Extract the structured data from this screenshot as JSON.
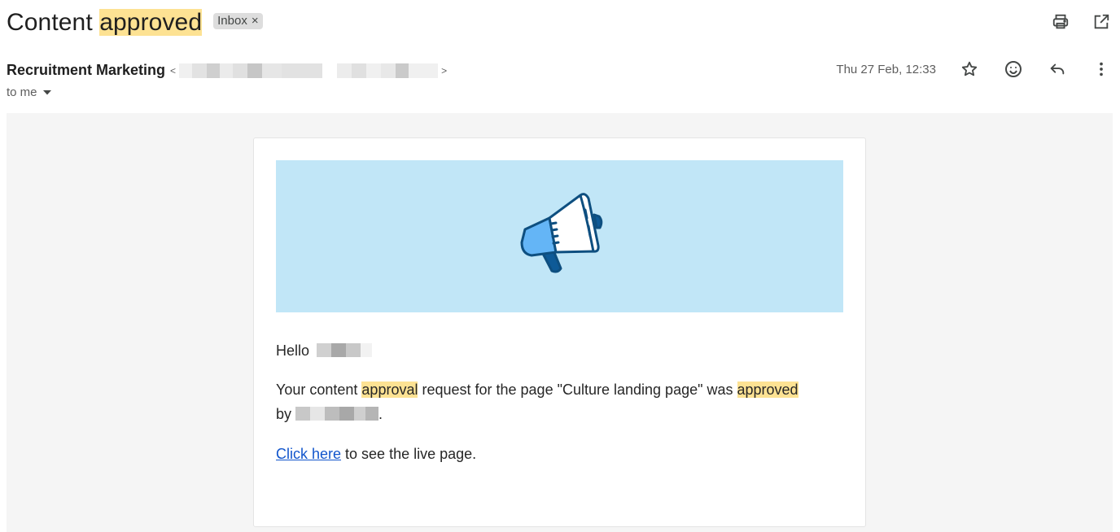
{
  "email": {
    "subject_prefix": "Content ",
    "subject_highlight": "approved",
    "label": "Inbox",
    "label_remove": "×",
    "sender_name": "Recruitment Marketing",
    "sender_email_open": "<",
    "sender_email_close": ">",
    "recipient": "to me",
    "date": "Thu 27 Feb, 12:33"
  },
  "icons": {
    "print": "print-icon",
    "open_new_window": "open-in-new-window-icon",
    "star": "star-icon",
    "emoji": "emoji-icon",
    "reply": "reply-icon",
    "more": "more-vert-icon",
    "dropdown": "dropdown-arrow-icon",
    "megaphone": "megaphone-icon"
  },
  "colors": {
    "highlight": "#fde293",
    "banner_bg": "#c1e6f7",
    "link": "#1155cc",
    "megaphone_dark": "#0e4f80",
    "megaphone_blue": "#64b5f6"
  },
  "body": {
    "greeting": "Hello",
    "line1_a": "Your content ",
    "line1_hl1": "approval",
    "line1_b": " request for the page \"Culture landing page\" was ",
    "line1_hl2": "approved",
    "line2_a": "by ",
    "line2_end": ".",
    "link_text": "Click here",
    "link_suffix": " to see the live page."
  }
}
